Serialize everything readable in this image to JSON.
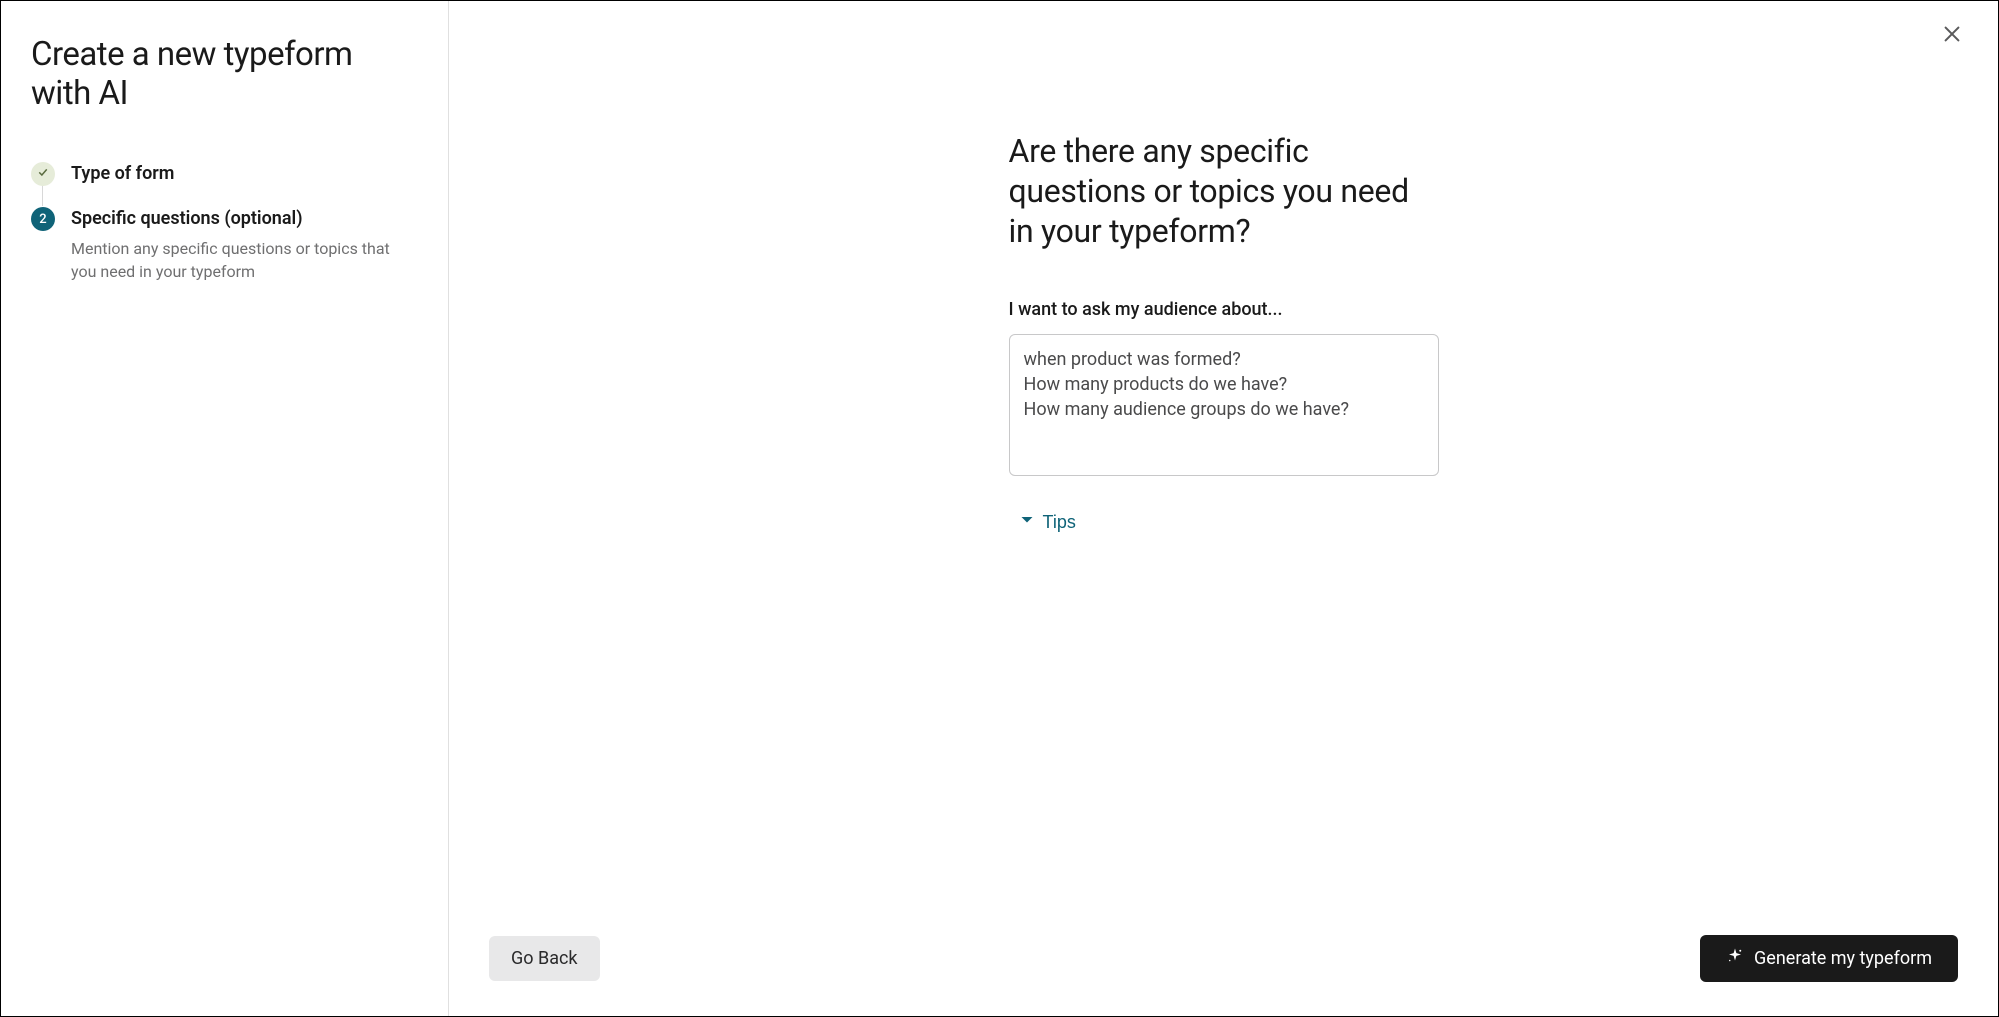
{
  "sidebar": {
    "title": "Create a new typeform with AI",
    "steps": [
      {
        "title": "Type of form",
        "completed": true
      },
      {
        "number": "2",
        "title": "Specific questions (optional)",
        "description": "Mention any specific questions or topics that you need in your typeform"
      }
    ]
  },
  "main": {
    "heading": "Are there any specific questions or topics you need in your typeform?",
    "field_label": "I want to ask my audience about...",
    "textarea_value": "when product was formed?\nHow many products do we have?\nHow many audience groups do we have?",
    "tips_label": "Tips"
  },
  "footer": {
    "back_label": "Go Back",
    "generate_label": "Generate my typeform"
  },
  "icons": {
    "close": "close-icon",
    "check": "check-icon",
    "chevron_down": "chevron-down-icon",
    "sparkle": "sparkle-icon"
  }
}
